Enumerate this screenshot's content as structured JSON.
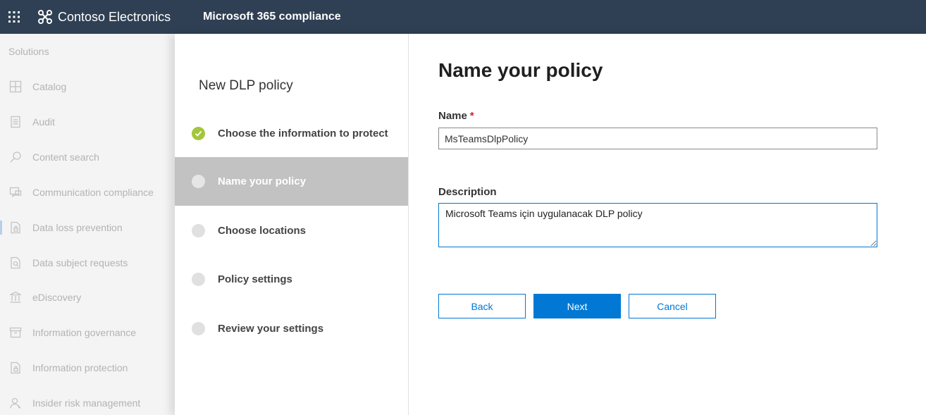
{
  "topbar": {
    "brand_name": "Contoso Electronics",
    "app_name": "Microsoft 365 compliance",
    "background": "#2f4054"
  },
  "leftnav": {
    "heading": "Solutions",
    "items": [
      {
        "label": "Catalog",
        "icon": "catalog-icon"
      },
      {
        "label": "Audit",
        "icon": "audit-icon"
      },
      {
        "label": "Content search",
        "icon": "search-icon"
      },
      {
        "label": "Communication compliance",
        "icon": "chat-icon"
      },
      {
        "label": "Data loss prevention",
        "icon": "dlp-icon",
        "active": true
      },
      {
        "label": "Data subject requests",
        "icon": "document-search-icon"
      },
      {
        "label": "eDiscovery",
        "icon": "bank-icon"
      },
      {
        "label": "Information governance",
        "icon": "archive-icon"
      },
      {
        "label": "Information protection",
        "icon": "lock-document-icon"
      },
      {
        "label": "Insider risk management",
        "icon": "person-icon"
      }
    ]
  },
  "wizard": {
    "title": "New DLP policy",
    "steps": [
      {
        "label": "Choose the information to protect",
        "state": "completed"
      },
      {
        "label": "Name your policy",
        "state": "current"
      },
      {
        "label": "Choose locations",
        "state": "pending"
      },
      {
        "label": "Policy settings",
        "state": "pending"
      },
      {
        "label": "Review your settings",
        "state": "pending"
      }
    ]
  },
  "form": {
    "title": "Name your policy",
    "name_label": "Name",
    "required_marker": "*",
    "name_value": "MsTeamsDlpPolicy",
    "description_label": "Description",
    "description_value": "Microsoft Teams için uygulanacak DLP policy",
    "buttons": {
      "back": "Back",
      "next": "Next",
      "cancel": "Cancel"
    }
  },
  "colors": {
    "accent": "#0078d4",
    "completed": "#a4c639",
    "current_step_bg": "#c2c2c2"
  }
}
